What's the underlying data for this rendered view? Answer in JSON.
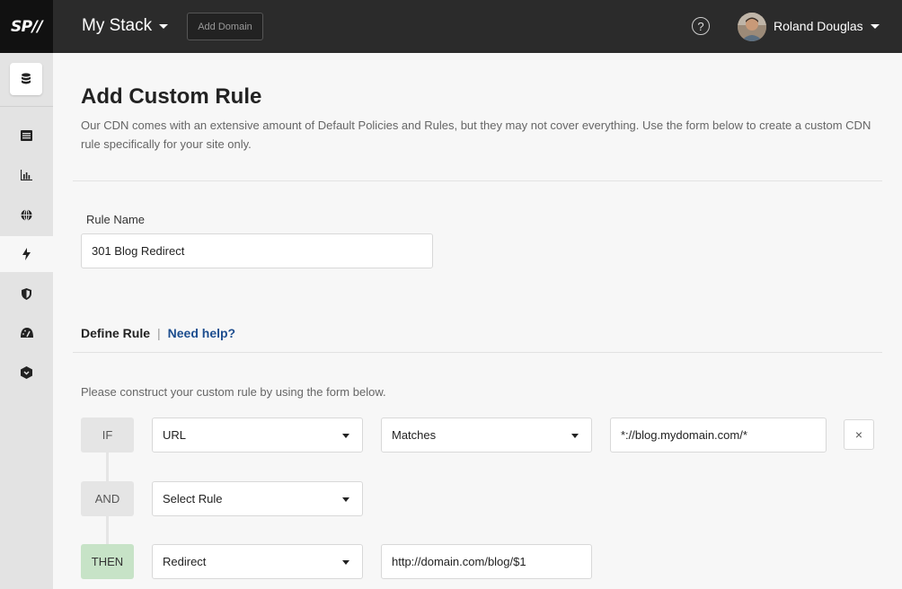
{
  "header": {
    "logo": "SP//",
    "stack_label": "My Stack",
    "add_domain_label": "Add Domain",
    "help_symbol": "?",
    "user_name": "Roland Douglas"
  },
  "sidebar": {
    "items": [
      {
        "icon": "database-icon"
      },
      {
        "icon": "list-icon"
      },
      {
        "icon": "bar-chart-icon"
      },
      {
        "icon": "globe-icon"
      },
      {
        "icon": "bolt-icon",
        "active": true
      },
      {
        "icon": "shield-icon"
      },
      {
        "icon": "gauge-icon"
      },
      {
        "icon": "box-icon"
      }
    ]
  },
  "page": {
    "title": "Add Custom Rule",
    "description": "Our CDN comes with an extensive amount of Default Policies and Rules, but they may not cover everything. Use the form below to create a custom CDN rule specifically for your site only.",
    "rule_name_label": "Rule Name",
    "rule_name_value": "301 Blog Redirect",
    "define_rule_label": "Define Rule",
    "separator": "|",
    "need_help_label": "Need help?",
    "instructions": "Please construct your custom rule by using the form below."
  },
  "rule": {
    "if_label": "IF",
    "if_field": "URL",
    "if_operator": "Matches",
    "if_value": "*://blog.mydomain.com/*",
    "remove_symbol": "×",
    "and_label": "AND",
    "and_field": "Select Rule",
    "then_label": "THEN",
    "then_action": "Redirect",
    "then_value": "http://domain.com/blog/$1"
  },
  "colors": {
    "topbar": "#2b2b2b",
    "sidebar": "#e3e3e3",
    "then_badge": "#c7e3c7",
    "link": "#1d4e8f"
  }
}
